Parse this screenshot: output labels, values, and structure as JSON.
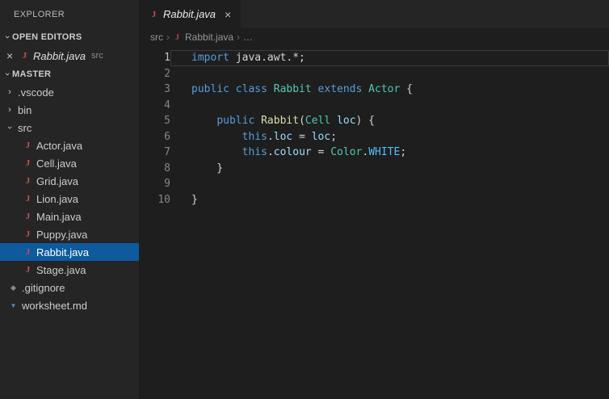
{
  "colors": {
    "keyword": "#569cd6",
    "type": "#4ec9b0",
    "function": "#dcdcaa",
    "variable": "#9cdcfe",
    "constant": "#4fc1ff",
    "plain": "#d4d4d4",
    "selection_bg": "#0e5a9e"
  },
  "icons": {
    "java": "J",
    "git": "◆",
    "markdown": "▼",
    "close": "×",
    "chevron": "›",
    "breadcrumb_sep": "›"
  },
  "sidebar": {
    "title": "EXPLORER",
    "open_editors": {
      "header": "OPEN EDITORS",
      "file": "Rabbit.java",
      "description": "src"
    },
    "workspace_header": "MASTER",
    "tree": {
      "vscode": ".vscode",
      "bin": "bin",
      "src": "src",
      "files": [
        "Actor.java",
        "Cell.java",
        "Grid.java",
        "Lion.java",
        "Main.java",
        "Puppy.java",
        "Rabbit.java",
        "Stage.java"
      ],
      "gitignore": ".gitignore",
      "worksheet": "worksheet.md"
    }
  },
  "editor": {
    "tab": {
      "label": "Rabbit.java"
    },
    "breadcrumb": [
      "src",
      "Rabbit.java",
      "…"
    ],
    "code": {
      "lines": [
        {
          "num": "1",
          "tokens": [
            {
              "t": "import",
              "c": "keyword"
            },
            {
              "t": " java.awt.*;",
              "c": "plain"
            }
          ]
        },
        {
          "num": "2",
          "tokens": []
        },
        {
          "num": "3",
          "tokens": [
            {
              "t": "public class ",
              "c": "keyword"
            },
            {
              "t": "Rabbit",
              "c": "type"
            },
            {
              "t": " ",
              "c": "plain"
            },
            {
              "t": "extends",
              "c": "keyword"
            },
            {
              "t": " ",
              "c": "plain"
            },
            {
              "t": "Actor",
              "c": "type"
            },
            {
              "t": " {",
              "c": "plain"
            }
          ]
        },
        {
          "num": "4",
          "tokens": []
        },
        {
          "num": "5",
          "tokens": [
            {
              "t": "    ",
              "c": "plain"
            },
            {
              "t": "public ",
              "c": "keyword"
            },
            {
              "t": "Rabbit",
              "c": "function"
            },
            {
              "t": "(",
              "c": "plain"
            },
            {
              "t": "Cell",
              "c": "type"
            },
            {
              "t": " ",
              "c": "plain"
            },
            {
              "t": "loc",
              "c": "variable"
            },
            {
              "t": ") {",
              "c": "plain"
            }
          ]
        },
        {
          "num": "6",
          "tokens": [
            {
              "t": "        ",
              "c": "plain"
            },
            {
              "t": "this",
              "c": "keyword"
            },
            {
              "t": ".",
              "c": "plain"
            },
            {
              "t": "loc",
              "c": "variable"
            },
            {
              "t": " = ",
              "c": "plain"
            },
            {
              "t": "loc",
              "c": "variable"
            },
            {
              "t": ";",
              "c": "plain"
            }
          ]
        },
        {
          "num": "7",
          "tokens": [
            {
              "t": "        ",
              "c": "plain"
            },
            {
              "t": "this",
              "c": "keyword"
            },
            {
              "t": ".",
              "c": "plain"
            },
            {
              "t": "colour",
              "c": "variable"
            },
            {
              "t": " = ",
              "c": "plain"
            },
            {
              "t": "Color",
              "c": "type"
            },
            {
              "t": ".",
              "c": "plain"
            },
            {
              "t": "WHITE",
              "c": "constant"
            },
            {
              "t": ";",
              "c": "plain"
            }
          ]
        },
        {
          "num": "8",
          "tokens": [
            {
              "t": "    }",
              "c": "plain"
            }
          ]
        },
        {
          "num": "9",
          "tokens": []
        },
        {
          "num": "10",
          "tokens": [
            {
              "t": "}",
              "c": "plain"
            }
          ]
        }
      ]
    }
  }
}
